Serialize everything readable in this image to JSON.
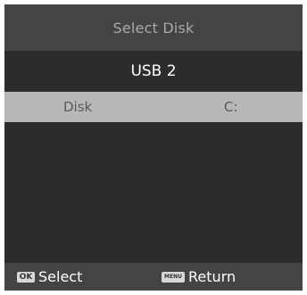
{
  "header": {
    "title": "Select Disk"
  },
  "device": {
    "name": "USB 2"
  },
  "disk_option": {
    "label": "Disk",
    "value": "C:"
  },
  "footer": {
    "ok_key": "OK",
    "ok_label": "Select",
    "menu_key": "MENU",
    "menu_label": "Return"
  },
  "colors": {
    "panel_background": "#2c2c2c",
    "bar_background": "#444444",
    "highlight_background": "#b8b8b8"
  }
}
